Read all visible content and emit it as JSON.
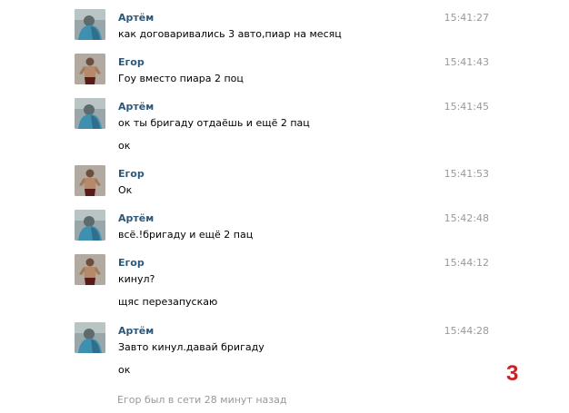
{
  "messages": [
    {
      "author": "Артём",
      "time": "15:41:27",
      "avatar": "artem-avatar",
      "lines": [
        "как договаривались 3 авто,пиар на месяц"
      ]
    },
    {
      "author": "Егор",
      "time": "15:41:43",
      "avatar": "egor-avatar",
      "lines": [
        "Гоу вместо пиара 2 поц"
      ]
    },
    {
      "author": "Артём",
      "time": "15:41:45",
      "avatar": "artem-avatar",
      "lines": [
        "ок ты бригаду отдаёшь и ещё 2 пац",
        "ок"
      ]
    },
    {
      "author": "Егор",
      "time": "15:41:53",
      "avatar": "egor-avatar",
      "lines": [
        "Ок"
      ]
    },
    {
      "author": "Артём",
      "time": "15:42:48",
      "avatar": "artem-avatar",
      "lines": [
        "всё.!бригаду и ещё 2 пац"
      ]
    },
    {
      "author": "Егор",
      "time": "15:44:12",
      "avatar": "egor-avatar",
      "lines": [
        "кинул?",
        "щяс перезапускаю"
      ]
    },
    {
      "author": "Артём",
      "time": "15:44:28",
      "avatar": "artem-avatar",
      "lines": [
        "Завто кинул.давай бригаду",
        "ок"
      ]
    }
  ],
  "status_text": "Егор был в сети 28 минут назад",
  "page_marker": "3",
  "colors": {
    "author": "#2b587a",
    "time": "#999999",
    "marker": "#cc1f1f"
  }
}
